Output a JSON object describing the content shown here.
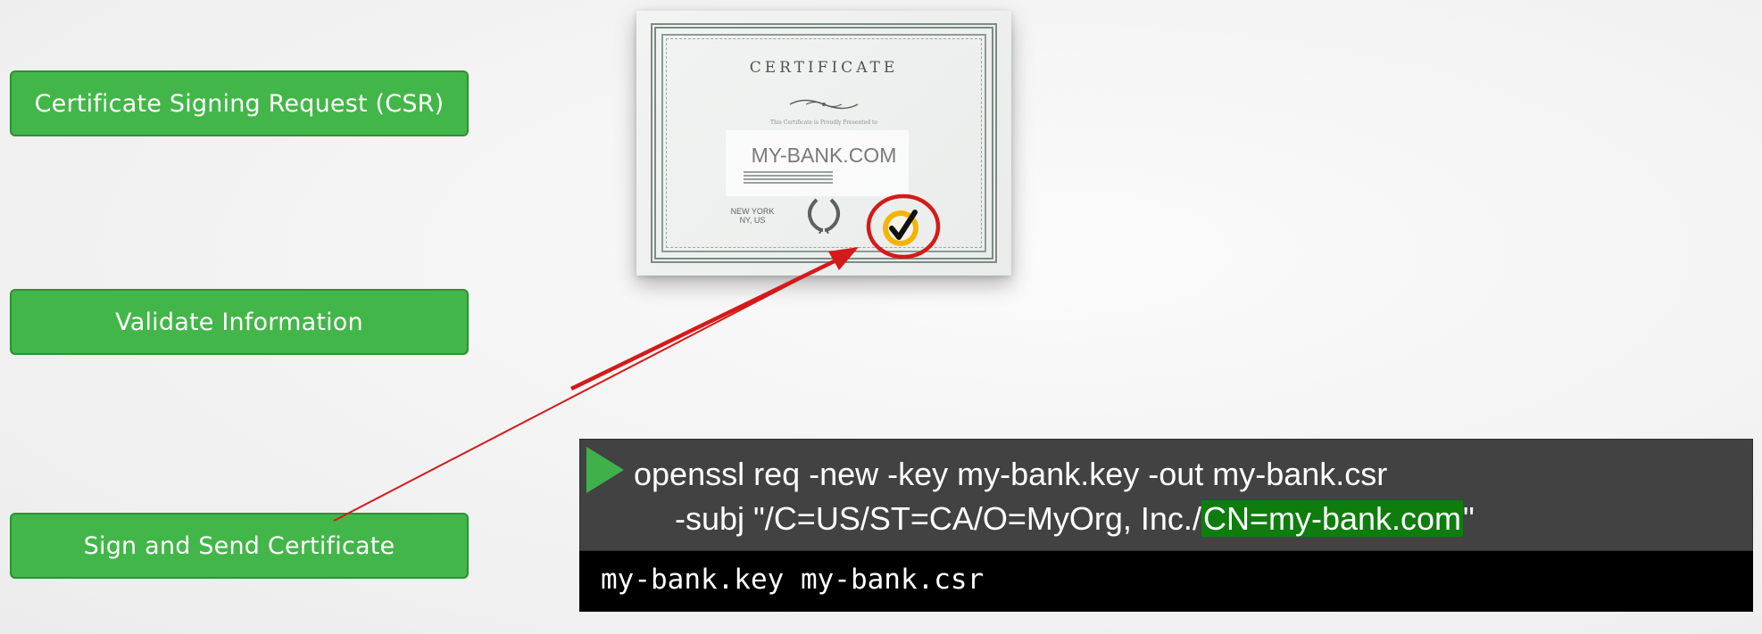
{
  "steps": [
    {
      "label": "Certificate Signing Request (CSR)"
    },
    {
      "label": "Validate Information"
    },
    {
      "label": "Sign and Send Certificate"
    }
  ],
  "certificate": {
    "title": "CERTIFICATE",
    "subtitle": "This Certificate is Proudly Presented to",
    "name": "MY-BANK.COM",
    "city_line1": "NEW YORK",
    "city_line2": "NY, US",
    "seal_icon": "checkmark-seal-icon",
    "seal_color": "#f5b400",
    "highlight_circle_color": "#d41a1a"
  },
  "command": {
    "line1": "openssl req -new -key my-bank.key -out my-bank.csr",
    "line2_prefix": "-subj \"/C=US/ST=CA/O=MyOrg, Inc./",
    "line2_highlight": "CN=my-bank.com",
    "line2_suffix": "\"",
    "highlight_color": "#0e7d0e"
  },
  "output": {
    "text": "my-bank.key my-bank.csr"
  },
  "colors": {
    "button_green": "#43b649",
    "arrow_red": "#d41a1a",
    "terminal_gray": "#424242"
  }
}
